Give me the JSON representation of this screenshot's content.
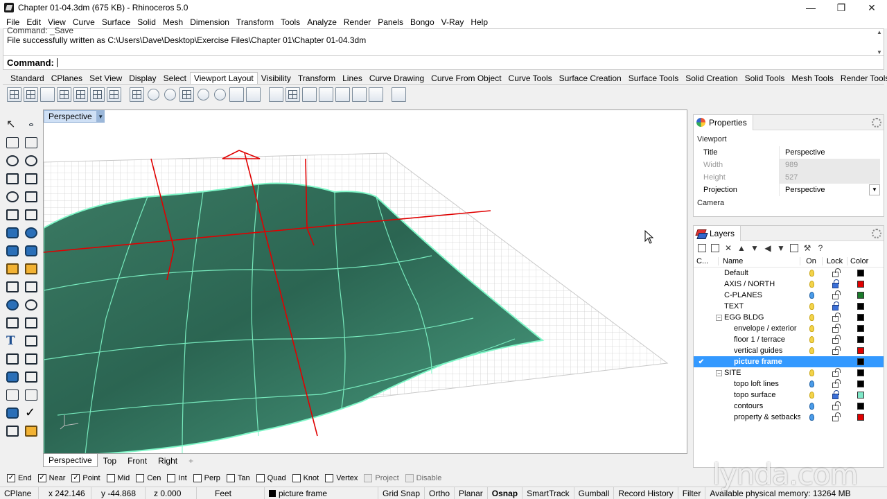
{
  "window": {
    "title": "Chapter 01-04.3dm (675 KB) - Rhinoceros 5.0",
    "controls": [
      "—",
      "❐",
      "✕"
    ]
  },
  "menu": [
    "File",
    "Edit",
    "View",
    "Curve",
    "Surface",
    "Solid",
    "Mesh",
    "Dimension",
    "Transform",
    "Tools",
    "Analyze",
    "Render",
    "Panels",
    "Bongo",
    "V-Ray",
    "Help"
  ],
  "command_history": {
    "line1": "Command: _Save",
    "line2": "File successfully written as C:\\Users\\Dave\\Desktop\\Exercise Files\\Chapter 01\\Chapter 01-04.3dm"
  },
  "command_prompt": {
    "label": "Command:",
    "value": ""
  },
  "toolbar_tabs": [
    "Standard",
    "CPlanes",
    "Set View",
    "Display",
    "Select",
    "Viewport Layout",
    "Visibility",
    "Transform",
    "Lines",
    "Curve Drawing",
    "Curve From Object",
    "Curve Tools",
    "Surface Creation",
    "Surface Tools",
    "Solid Creation",
    "Solid Tools",
    "Mesh Tools",
    "Render Tools"
  ],
  "active_toolbar_tab": "Viewport Layout",
  "toolbar_overflow": "|»",
  "viewport": {
    "title": "Perspective",
    "dropdown": "▼"
  },
  "viewport_tabs": [
    "Perspective",
    "Top",
    "Front",
    "Right",
    "+"
  ],
  "properties": {
    "tab_label": "Properties",
    "section": "Viewport",
    "camera_section": "Camera",
    "rows": [
      {
        "key": "Title",
        "value": "Perspective",
        "disabled": false
      },
      {
        "key": "Width",
        "value": "989",
        "disabled": true
      },
      {
        "key": "Height",
        "value": "527",
        "disabled": true
      },
      {
        "key": "Projection",
        "value": "Perspective",
        "disabled": false
      }
    ]
  },
  "layers": {
    "tab_label": "Layers",
    "columns": {
      "current": "C...",
      "name": "Name",
      "on": "On",
      "lock": "Lock",
      "color": "Color"
    },
    "rows": [
      {
        "name": "Default",
        "indent": 0,
        "bulb": "yellow",
        "locked": false,
        "color": "#000000",
        "selected": false,
        "expander": ""
      },
      {
        "name": "AXIS / NORTH",
        "indent": 0,
        "bulb": "yellow",
        "locked": true,
        "color": "#e00000",
        "selected": false,
        "expander": ""
      },
      {
        "name": "C-PLANES",
        "indent": 0,
        "bulb": "blue",
        "locked": false,
        "color": "#1a7a2a",
        "selected": false,
        "expander": ""
      },
      {
        "name": "TEXT",
        "indent": 0,
        "bulb": "yellow",
        "locked": true,
        "color": "#000000",
        "selected": false,
        "expander": ""
      },
      {
        "name": "EGG BLDG",
        "indent": 0,
        "bulb": "yellow",
        "locked": false,
        "color": "#000000",
        "selected": false,
        "expander": "−"
      },
      {
        "name": "envelope / exterior",
        "indent": 1,
        "bulb": "yellow",
        "locked": false,
        "color": "#000000",
        "selected": false,
        "expander": ""
      },
      {
        "name": "floor 1 / terrace",
        "indent": 1,
        "bulb": "yellow",
        "locked": false,
        "color": "#000000",
        "selected": false,
        "expander": ""
      },
      {
        "name": "vertical guides",
        "indent": 1,
        "bulb": "yellow",
        "locked": false,
        "color": "#e00000",
        "selected": false,
        "expander": ""
      },
      {
        "name": "picture frame",
        "indent": 1,
        "bulb": "none",
        "locked": false,
        "color": "#000000",
        "selected": true,
        "expander": ""
      },
      {
        "name": "SITE",
        "indent": 0,
        "bulb": "yellow",
        "locked": false,
        "color": "#000000",
        "selected": false,
        "expander": "−"
      },
      {
        "name": "topo loft lines",
        "indent": 1,
        "bulb": "blue",
        "locked": false,
        "color": "#000000",
        "selected": false,
        "expander": ""
      },
      {
        "name": "topo surface",
        "indent": 1,
        "bulb": "yellow",
        "locked": true,
        "color": "#7fe8c8",
        "selected": false,
        "expander": ""
      },
      {
        "name": "contours",
        "indent": 1,
        "bulb": "blue",
        "locked": false,
        "color": "#000000",
        "selected": false,
        "expander": ""
      },
      {
        "name": "property & setbacks",
        "indent": 1,
        "bulb": "blue",
        "locked": false,
        "color": "#e00000",
        "selected": false,
        "expander": ""
      }
    ]
  },
  "osnaps": [
    {
      "label": "End",
      "checked": true,
      "disabled": false
    },
    {
      "label": "Near",
      "checked": true,
      "disabled": false
    },
    {
      "label": "Point",
      "checked": true,
      "disabled": false
    },
    {
      "label": "Mid",
      "checked": false,
      "disabled": false
    },
    {
      "label": "Cen",
      "checked": false,
      "disabled": false
    },
    {
      "label": "Int",
      "checked": false,
      "disabled": false
    },
    {
      "label": "Perp",
      "checked": false,
      "disabled": false
    },
    {
      "label": "Tan",
      "checked": false,
      "disabled": false
    },
    {
      "label": "Quad",
      "checked": false,
      "disabled": false
    },
    {
      "label": "Knot",
      "checked": false,
      "disabled": false
    },
    {
      "label": "Vertex",
      "checked": false,
      "disabled": false
    },
    {
      "label": "Project",
      "checked": false,
      "disabled": true
    },
    {
      "label": "Disable",
      "checked": false,
      "disabled": true
    }
  ],
  "status": {
    "cplane": "CPlane",
    "x": "x 242.146",
    "y": "y -44.868",
    "z": "z 0.000",
    "units": "Feet",
    "layer": "picture frame",
    "grid_snap": "Grid Snap",
    "ortho": "Ortho",
    "planar": "Planar",
    "osnap": "Osnap",
    "smarttrack": "SmartTrack",
    "gumball": "Gumball",
    "record_history": "Record History",
    "filter": "Filter",
    "memory": "Available physical memory: 13264 MB"
  },
  "watermark": "lynda.com",
  "colors": {
    "surface": "#2f6e58",
    "surface_edge": "#7ff7c8",
    "guides": "#e00000",
    "selection": "#3399ff"
  }
}
